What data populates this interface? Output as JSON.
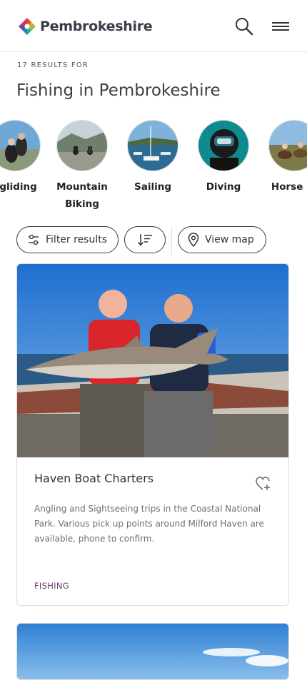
{
  "header": {
    "brand": "Pembrokeshire",
    "brand_color": "#3d3a4a"
  },
  "results": {
    "count_label": "17 RESULTS FOR",
    "title": "Fishing in Pembrokeshire"
  },
  "activities": [
    {
      "label": "agliding",
      "icon": "paragliding-photo"
    },
    {
      "label": "Mountain Biking",
      "icon": "mountain-biking-photo"
    },
    {
      "label": "Sailing",
      "icon": "sailing-photo"
    },
    {
      "label": "Diving",
      "icon": "diving-photo"
    },
    {
      "label": "Horse Ri",
      "icon": "horse-riding-photo"
    }
  ],
  "filters": {
    "filter_label": "Filter results",
    "map_label": "View map"
  },
  "card": {
    "title": "Haven Boat Charters",
    "description": "Angling and Sightseeing trips in the Coastal National Park. Various pick up points around Milford Haven are available, phone to confirm.",
    "tag": "FISHING",
    "tag_color": "#6a3c6c"
  },
  "colors": {
    "border": "#dddddd",
    "text": "#333333"
  }
}
